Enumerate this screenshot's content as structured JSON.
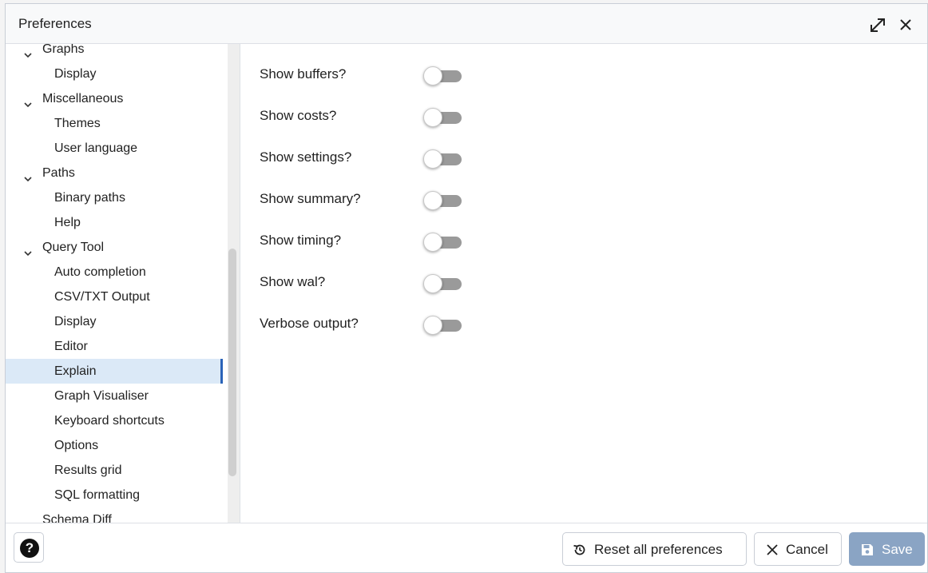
{
  "dialog": {
    "title": "Preferences"
  },
  "tree": [
    {
      "label": "Graphs",
      "kind": "parent"
    },
    {
      "label": "Display",
      "kind": "child"
    },
    {
      "label": "Miscellaneous",
      "kind": "parent"
    },
    {
      "label": "Themes",
      "kind": "child"
    },
    {
      "label": "User language",
      "kind": "child"
    },
    {
      "label": "Paths",
      "kind": "parent"
    },
    {
      "label": "Binary paths",
      "kind": "child"
    },
    {
      "label": "Help",
      "kind": "child"
    },
    {
      "label": "Query Tool",
      "kind": "parent"
    },
    {
      "label": "Auto completion",
      "kind": "child"
    },
    {
      "label": "CSV/TXT Output",
      "kind": "child"
    },
    {
      "label": "Display",
      "kind": "child"
    },
    {
      "label": "Editor",
      "kind": "child"
    },
    {
      "label": "Explain",
      "kind": "child",
      "selected": true
    },
    {
      "label": "Graph Visualiser",
      "kind": "child"
    },
    {
      "label": "Keyboard shortcuts",
      "kind": "child"
    },
    {
      "label": "Options",
      "kind": "child"
    },
    {
      "label": "Results grid",
      "kind": "child"
    },
    {
      "label": "SQL formatting",
      "kind": "child"
    },
    {
      "label": "Schema Diff",
      "kind": "parent"
    }
  ],
  "settings": [
    {
      "label": "Show buffers?",
      "enabled": false
    },
    {
      "label": "Show costs?",
      "enabled": false
    },
    {
      "label": "Show settings?",
      "enabled": false
    },
    {
      "label": "Show summary?",
      "enabled": false
    },
    {
      "label": "Show timing?",
      "enabled": false
    },
    {
      "label": "Show wal?",
      "enabled": false
    },
    {
      "label": "Verbose output?",
      "enabled": false
    }
  ],
  "footer": {
    "help_icon": "question-circle-icon",
    "reset_label": "Reset all preferences",
    "reset_icon": "reset-icon",
    "cancel_label": "Cancel",
    "cancel_icon": "close-icon",
    "save_label": "Save",
    "save_icon": "floppy-disk-icon",
    "save_enabled": false
  },
  "colors": {
    "selected_bg": "#dbe9f7",
    "selected_accent": "#2a63b8",
    "toggle_off": "#9a9a9a",
    "save_disabled": "#8aa4c4"
  }
}
